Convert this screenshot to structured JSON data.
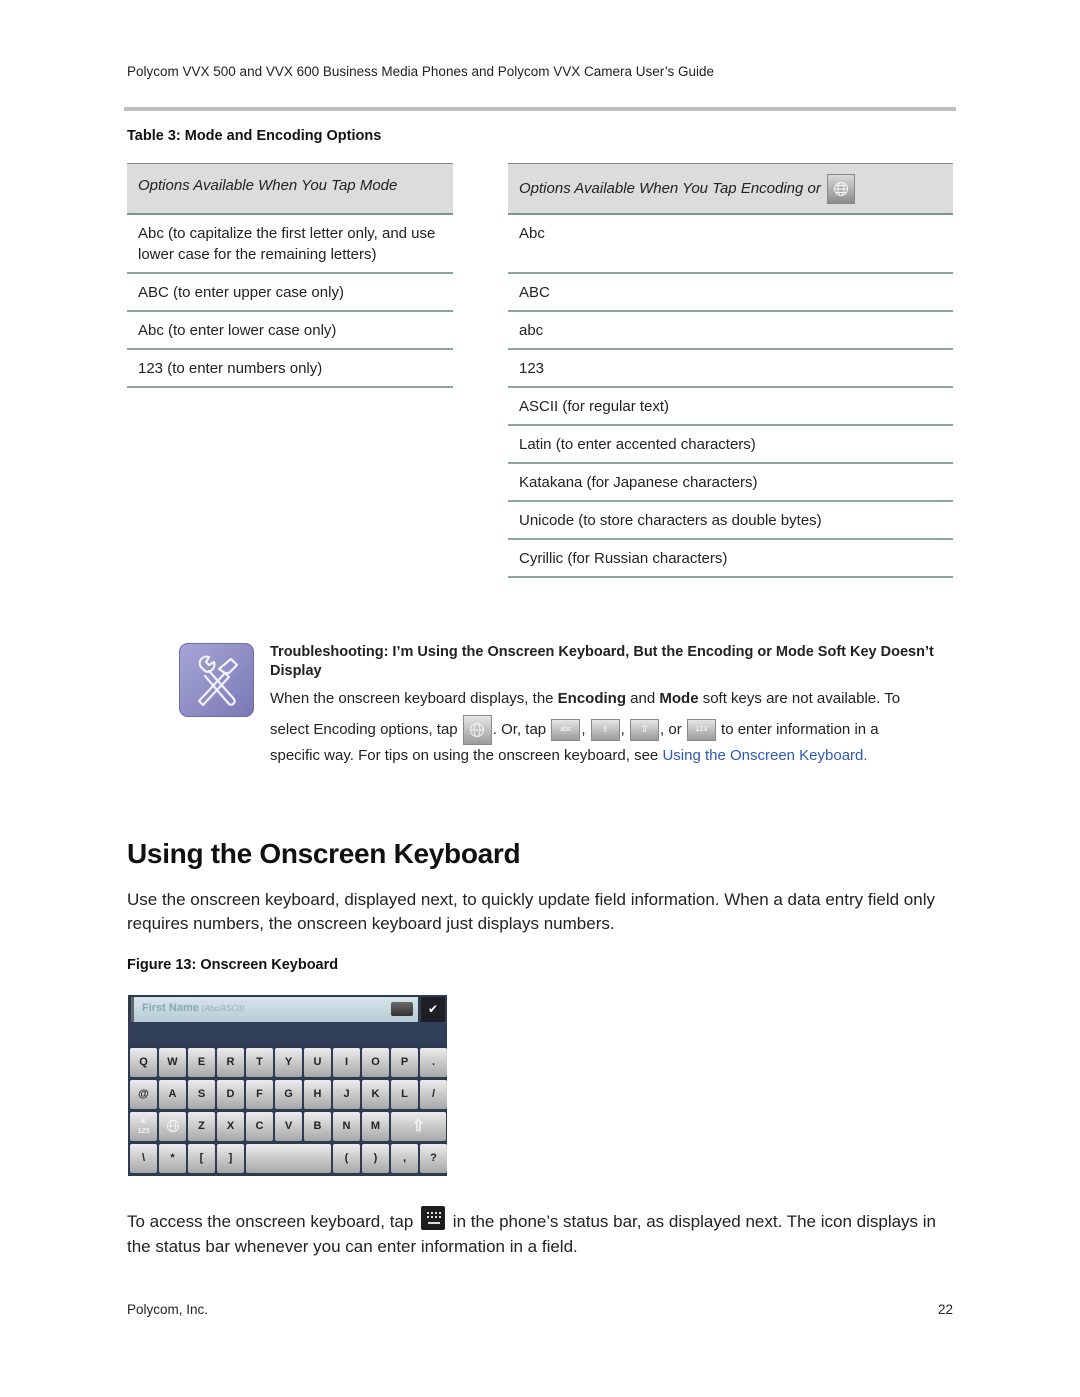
{
  "header": {
    "running_title": "Polycom VVX 500 and VVX 600 Business Media Phones and Polycom VVX Camera User’s Guide"
  },
  "table": {
    "caption": "Table 3: Mode and Encoding Options",
    "mode_column": {
      "header": "Options Available When You Tap Mode",
      "rows": [
        "Abc (to capitalize the first letter only, and use lower case for the remaining letters)",
        "ABC (to enter upper case only)",
        "Abc (to enter lower case only)",
        "123 (to enter numbers only)"
      ]
    },
    "encoding_column": {
      "header": "Options Available When You Tap Encoding or",
      "header_icon": "globe-icon",
      "rows": [
        "Abc",
        "ABC",
        "abc",
        "123",
        "ASCII (for regular text)",
        "Latin (to enter accented characters)",
        "Katakana (for Japanese characters)",
        "Unicode (to store characters as double bytes)",
        "Cyrillic (for Russian characters)"
      ]
    }
  },
  "tip": {
    "icon": "tools-icon",
    "title": "Troubleshooting: I’m Using the Onscreen Keyboard, But the Encoding or Mode Soft Key Doesn’t Display",
    "line1_a": "When the onscreen keyboard displays, the ",
    "line1_bold1": "Encoding",
    "line1_b": " and ",
    "line1_bold2": "Mode",
    "line1_c": " soft keys are not available. To",
    "line2_a": "select Encoding options, tap ",
    "line2_b": ". Or, tap ",
    "comma": ",",
    "line2_or": ", or",
    "line2_c": " to enter information in a",
    "line3_a": "specific way. For tips on using the onscreen keyboard, see ",
    "link_text": "Using the Onscreen Keyboard.",
    "key_labels": {
      "abc": "abc",
      "shift_a": "A",
      "num": "123"
    }
  },
  "section": {
    "title": "Using the Onscreen Keyboard",
    "intro": "Use the onscreen keyboard, displayed next, to quickly update field information. When a data entry field only requires numbers, the onscreen keyboard just displays numbers.",
    "figure_caption": "Figure 13: Onscreen Keyboard",
    "access_a": "To access the onscreen keyboard, tap ",
    "access_b": " in the phone’s status bar, as displayed next. The icon displays in the status bar whenever you can enter information in a field."
  },
  "keyboard": {
    "field_placeholder": "First Name",
    "field_hint": "(Abc/ASCII)",
    "ok_label": "✔",
    "rows": [
      [
        "Q",
        "W",
        "E",
        "R",
        "T",
        "Y",
        "U",
        "I",
        "O",
        "P",
        "."
      ],
      [
        "@",
        "A",
        "S",
        "D",
        "F",
        "G",
        "H",
        "J",
        "K",
        "L",
        "/"
      ],
      [
        "&\n123",
        "globe",
        "Z",
        "X",
        "C",
        "V",
        "B",
        "N",
        "M",
        "shift"
      ],
      [
        "\\",
        "*",
        "[",
        "]",
        "space",
        "(",
        ")",
        ",",
        "?"
      ]
    ]
  },
  "footer": {
    "company": "Polycom, Inc.",
    "page_number": "22"
  }
}
